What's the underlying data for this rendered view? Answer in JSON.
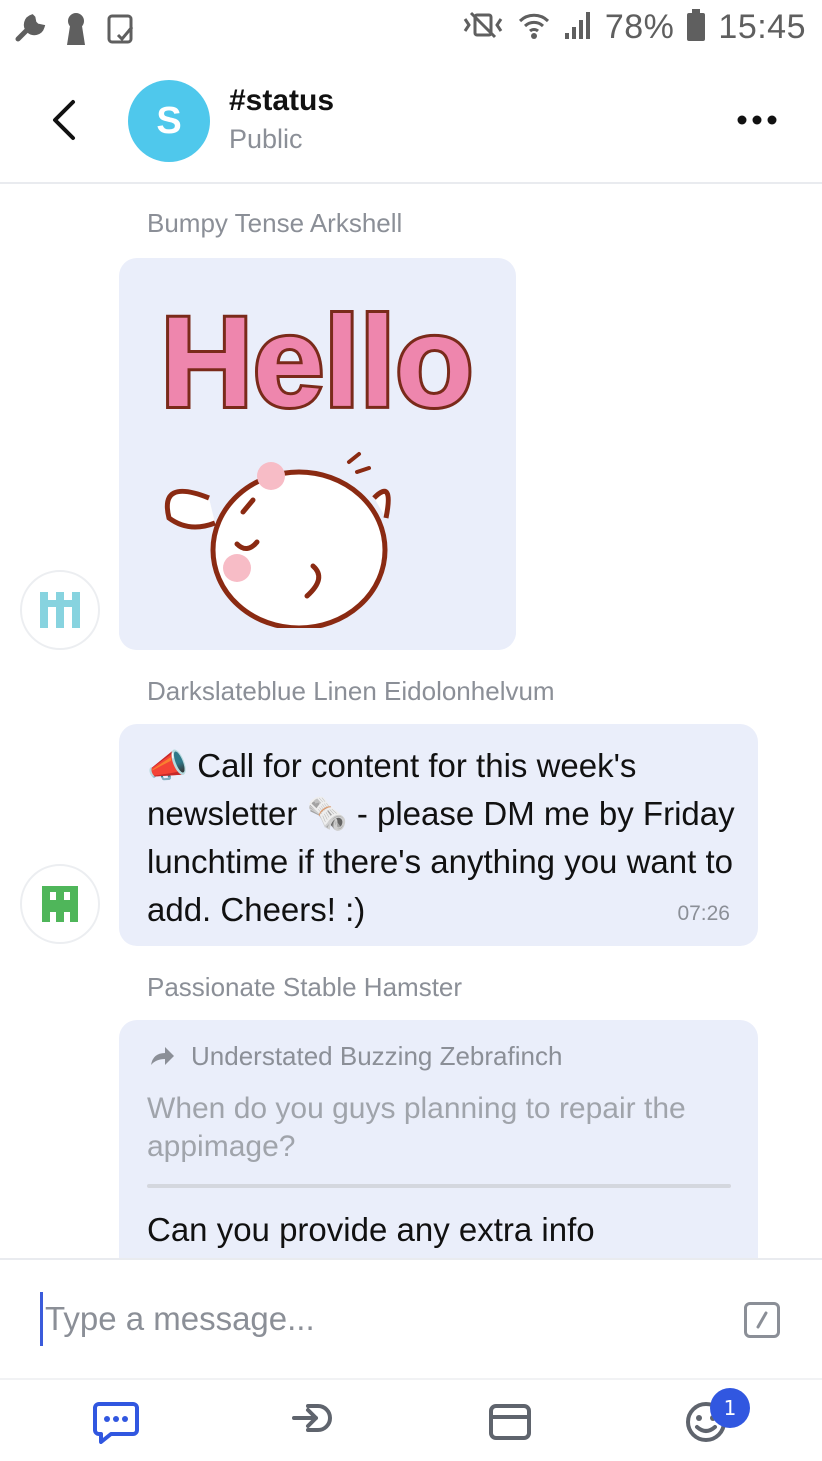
{
  "status_bar": {
    "battery_percent": "78%",
    "time": "15:45",
    "icons": [
      "wrench-icon",
      "keyhole-icon",
      "screenshot-icon",
      "mute-icon",
      "wifi-icon",
      "signal-icon",
      "battery-icon"
    ]
  },
  "header": {
    "avatar_letter": "S",
    "avatar_color": "#4fc8ec",
    "channel_name": "#status",
    "channel_type": "Public"
  },
  "messages": [
    {
      "sender": "Bumpy Tense Arkshell",
      "type": "sticker",
      "sticker_text": "Hello"
    },
    {
      "sender": "Darkslateblue Linen Eidolonhelvum",
      "type": "text",
      "text": "📣 Call for content for this week's newsletter 🗞️ - please DM me by Friday lunchtime if there's anything you want to add. Cheers! :)",
      "time": "07:26"
    },
    {
      "sender": "Passionate Stable Hamster",
      "type": "reply",
      "reply_to_author": "Understated Buzzing Zebrafinch",
      "reply_to_text": "When do you guys planning to repair the appimage?",
      "text": "Can you provide any extra info"
    }
  ],
  "composer": {
    "placeholder": "Type a message..."
  },
  "bottom_nav": {
    "items": [
      "chat-icon",
      "logout-icon",
      "wallet-icon",
      "emoji-icon"
    ],
    "badge_count": "1",
    "accent": "#3157e0"
  }
}
